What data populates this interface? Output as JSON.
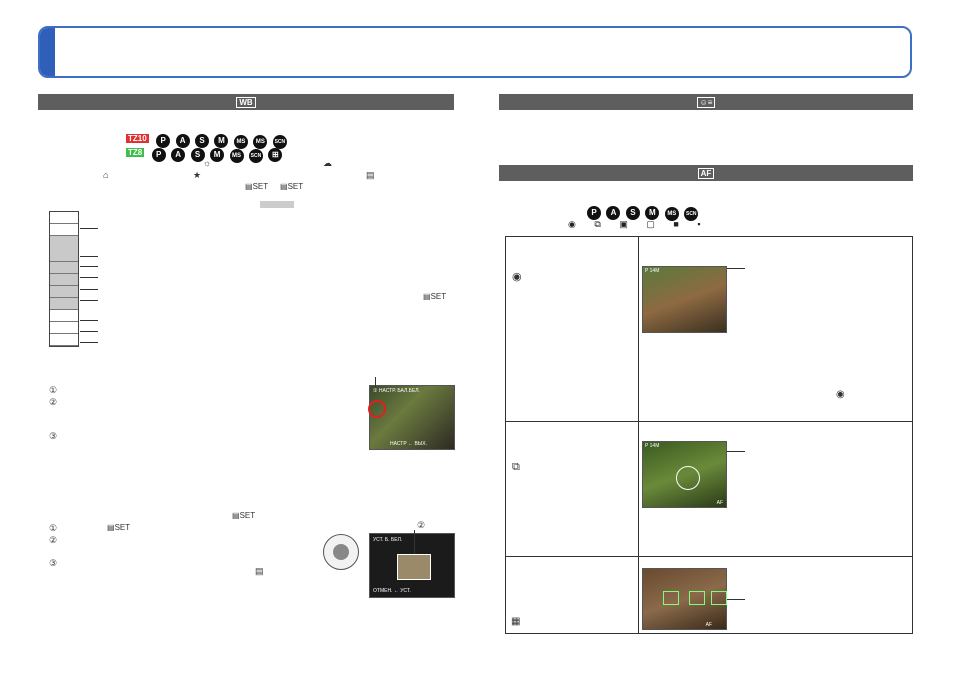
{
  "page": {
    "left_section_icon": "WB",
    "right_section1_icon": "face-recognition-icon",
    "right_section2_icon": "AF-mode-icon"
  },
  "left": {
    "model1": "TZ10",
    "model2": "TZ8",
    "model1_color": "#e03030",
    "model2_color": "#3fbf4a",
    "modes1": [
      "P",
      "A",
      "S",
      "M",
      "MS",
      "MS",
      "SCN"
    ],
    "modes2": [
      "P",
      "A",
      "S",
      "M",
      "MS",
      "SCN",
      "⊞"
    ],
    "steps1": [
      "①",
      "②",
      "③"
    ],
    "steps2": [
      "①",
      "②",
      "③"
    ],
    "photo1_overlay_top": "① НАСТР. БАЛ.БЕЛ.",
    "photo1_overlay_bottom": "НАСТР ← ВЫХ.",
    "photo2_overlay_top": "УСТ. Б. БЕЛ.",
    "photo2_overlay_bottom": "ОТМЕН. ← УСТ.",
    "photo2_callout": "②",
    "set_label": "SET"
  },
  "right": {
    "modes": [
      "P",
      "A",
      "S",
      "M",
      "MS",
      "SCN"
    ],
    "af_icons": [
      "◉",
      "⧉",
      "▣",
      "▢",
      "■",
      "▪"
    ],
    "photo1_top": "P 14M",
    "photo2_top": "P 14M",
    "photo2_bottom": "AF",
    "photo3_bottom": "AF"
  },
  "colors": {
    "accent": "#3d6fc4",
    "section_bg": "#5e5e5e"
  }
}
